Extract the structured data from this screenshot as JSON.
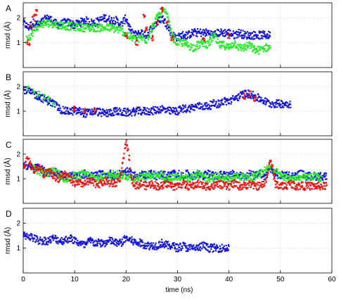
{
  "xlabel": "time (ns)",
  "ylabel": "rmsd (Å)",
  "series_colors": {
    "blue": "#1010e0",
    "green": "#22ee22",
    "red": "#ee1111"
  },
  "chart_data": [
    {
      "panel": "A",
      "type": "scatter",
      "xlim": [
        0,
        60
      ],
      "ylim": [
        0,
        2.6
      ],
      "grid": true,
      "x_ticks": [
        0,
        10,
        20,
        30,
        40,
        50,
        60
      ],
      "y_ticks": [
        1,
        2
      ],
      "series": [
        {
          "color": "blue",
          "x": [
            0,
            1,
            2,
            3,
            4,
            5,
            6,
            7,
            8,
            9,
            10,
            11,
            12,
            13,
            14,
            15,
            16,
            17,
            18,
            19,
            20,
            21,
            22,
            23,
            24,
            25,
            26,
            27,
            28,
            29,
            30,
            31,
            32,
            33,
            34,
            35,
            36,
            37,
            38,
            39,
            40,
            41,
            42,
            43,
            44,
            45,
            46,
            47,
            48
          ],
          "y": [
            1.8,
            1.6,
            1.8,
            1.7,
            1.9,
            2.0,
            1.8,
            1.7,
            1.8,
            1.8,
            1.7,
            1.8,
            1.9,
            1.8,
            1.8,
            1.9,
            2.0,
            1.9,
            1.9,
            1.7,
            2.0,
            1.4,
            1.3,
            1.4,
            1.3,
            1.6,
            1.8,
            2.0,
            1.7,
            1.3,
            1.2,
            1.3,
            1.3,
            1.4,
            1.4,
            1.4,
            1.4,
            1.3,
            1.4,
            1.4,
            1.4,
            1.3,
            1.4,
            1.3,
            1.3,
            1.3,
            1.3,
            1.3,
            1.3
          ]
        },
        {
          "color": "green",
          "x": [
            0.5,
            1.5,
            3,
            5,
            7,
            12,
            17,
            19,
            21,
            22,
            23,
            24,
            26,
            27,
            28,
            29,
            30,
            31,
            32,
            33,
            34,
            35,
            36,
            37,
            38,
            39,
            40,
            41,
            42,
            43,
            44,
            45,
            46,
            47,
            48
          ],
          "y": [
            1.1,
            1.3,
            1.7,
            1.8,
            1.7,
            1.6,
            1.6,
            1.5,
            1.2,
            1.1,
            1.2,
            1.1,
            2.0,
            2.3,
            2.1,
            1.2,
            1.0,
            1.0,
            0.9,
            0.8,
            0.9,
            1.0,
            0.9,
            1.3,
            0.9,
            0.9,
            0.8,
            1.0,
            0.8,
            0.8,
            0.9,
            0.7,
            0.7,
            0.8,
            0.8
          ]
        },
        {
          "color": "red",
          "x": [
            1,
            1.5,
            2,
            2.5,
            20,
            22,
            23.5,
            24,
            25,
            26,
            27,
            28,
            29,
            35,
            40
          ],
          "y": [
            1.0,
            1.6,
            2.0,
            2.2,
            1.3,
            1.0,
            2.0,
            1.5,
            1.2,
            1.8,
            2.3,
            1.8,
            1.2,
            1.2,
            1.3
          ]
        }
      ]
    },
    {
      "panel": "B",
      "type": "scatter",
      "xlim": [
        0,
        60
      ],
      "ylim": [
        0,
        2.6
      ],
      "grid": true,
      "x_ticks": [
        0,
        10,
        20,
        30,
        40,
        50,
        60
      ],
      "y_ticks": [
        1,
        2
      ],
      "series": [
        {
          "color": "blue",
          "x": [
            0,
            1,
            2,
            3,
            4,
            5,
            6,
            7,
            8,
            9,
            10,
            11,
            12,
            13,
            14,
            15,
            16,
            17,
            18,
            19,
            20,
            21,
            22,
            23,
            24,
            25,
            26,
            27,
            28,
            29,
            30,
            31,
            32,
            33,
            34,
            35,
            36,
            37,
            38,
            39,
            40,
            41,
            42,
            43,
            44,
            45,
            46,
            47,
            48,
            49,
            50,
            51,
            52
          ],
          "y": [
            1.9,
            1.8,
            1.7,
            1.6,
            1.5,
            1.4,
            1.3,
            1.1,
            1.0,
            1.0,
            1.0,
            1.0,
            0.9,
            0.95,
            1.0,
            0.95,
            0.9,
            0.95,
            1.0,
            0.95,
            0.95,
            0.95,
            1.0,
            1.0,
            1.0,
            1.0,
            1.05,
            1.1,
            1.0,
            1.0,
            1.0,
            1.1,
            1.1,
            1.15,
            1.2,
            1.2,
            1.2,
            1.3,
            1.3,
            1.4,
            1.4,
            1.5,
            1.6,
            1.7,
            1.7,
            1.6,
            1.5,
            1.4,
            1.3,
            1.3,
            1.3,
            1.3,
            1.3
          ]
        },
        {
          "color": "green",
          "x": [
            1,
            2,
            3,
            4,
            5,
            6
          ],
          "y": [
            1.9,
            1.8,
            1.7,
            1.6,
            1.5,
            1.3
          ]
        },
        {
          "color": "red",
          "x": [
            10,
            12,
            14,
            43,
            44,
            45
          ],
          "y": [
            1.1,
            1.0,
            1.0,
            1.6,
            1.7,
            1.5
          ]
        }
      ]
    },
    {
      "panel": "C",
      "type": "scatter",
      "xlim": [
        0,
        60
      ],
      "ylim": [
        0,
        2.6
      ],
      "grid": true,
      "x_ticks": [
        0,
        10,
        20,
        30,
        40,
        50,
        60
      ],
      "y_ticks": [
        1,
        2
      ],
      "series": [
        {
          "color": "blue",
          "x": [
            0,
            1,
            2,
            3,
            4,
            5,
            6,
            7,
            8,
            9,
            10,
            11,
            12,
            13,
            14,
            15,
            16,
            17,
            18,
            19,
            20,
            21,
            22,
            23,
            24,
            25,
            26,
            27,
            28,
            29,
            30,
            31,
            32,
            33,
            34,
            35,
            36,
            37,
            38,
            39,
            40,
            41,
            42,
            43,
            44,
            45,
            46,
            47,
            48,
            49,
            50,
            51,
            52,
            53,
            54,
            55,
            56,
            57,
            58,
            59
          ],
          "y": [
            1.6,
            1.5,
            1.4,
            1.5,
            1.3,
            1.2,
            1.3,
            1.2,
            1.1,
            1.1,
            1.1,
            1.1,
            1.2,
            1.1,
            1.1,
            1.2,
            1.1,
            1.2,
            1.1,
            1.2,
            1.3,
            1.2,
            1.1,
            1.2,
            1.1,
            1.2,
            1.1,
            1.2,
            1.1,
            1.2,
            1.2,
            1.1,
            1.2,
            1.1,
            1.2,
            1.1,
            1.2,
            1.1,
            1.1,
            1.2,
            1.1,
            1.2,
            1.1,
            1.1,
            1.2,
            1.1,
            1.2,
            1.1,
            1.4,
            1.2,
            1.1,
            1.2,
            1.1,
            1.1,
            1.2,
            1.1,
            1.1,
            1.1,
            1.1,
            1.1
          ]
        },
        {
          "color": "green",
          "x": [
            2,
            4,
            6,
            8,
            10,
            12,
            14,
            16,
            18,
            22,
            24,
            26,
            28,
            30,
            32,
            34,
            36,
            38,
            40,
            42,
            44,
            46,
            48,
            50,
            52,
            54,
            56,
            58
          ],
          "y": [
            1.4,
            1.2,
            1.3,
            1.0,
            1.1,
            1.2,
            1.0,
            1.1,
            1.2,
            1.0,
            1.1,
            1.2,
            1.0,
            1.1,
            1.0,
            1.2,
            1.0,
            1.1,
            1.0,
            1.1,
            1.0,
            1.2,
            1.5,
            1.1,
            1.0,
            1.0,
            1.1,
            1.0
          ]
        },
        {
          "color": "red",
          "x": [
            0,
            1,
            2,
            3,
            4,
            5,
            6,
            7,
            8,
            9,
            10,
            11,
            12,
            13,
            14,
            15,
            16,
            17,
            18,
            19,
            19.5,
            20,
            20.5,
            21,
            22,
            23,
            24,
            25,
            26,
            27,
            28,
            29,
            30,
            31,
            32,
            33,
            34,
            35,
            36,
            37,
            38,
            39,
            40,
            41,
            42,
            43,
            44,
            45,
            46,
            47,
            47.5,
            48,
            48.5,
            49,
            50,
            51,
            52,
            53,
            54,
            55,
            56,
            57,
            58,
            59
          ],
          "y": [
            1.5,
            1.8,
            1.3,
            1.5,
            1.2,
            1.4,
            1.1,
            1.0,
            1.2,
            1.0,
            0.8,
            0.8,
            0.8,
            0.9,
            0.8,
            0.8,
            0.9,
            0.8,
            0.8,
            1.1,
            1.8,
            2.5,
            2.0,
            1.0,
            0.7,
            0.8,
            0.7,
            0.8,
            0.7,
            0.7,
            0.8,
            0.7,
            0.7,
            0.8,
            0.7,
            0.7,
            0.8,
            0.7,
            0.7,
            0.7,
            0.8,
            0.7,
            0.7,
            0.8,
            0.7,
            0.7,
            0.8,
            0.7,
            0.7,
            0.8,
            1.2,
            1.8,
            1.3,
            0.8,
            0.7,
            0.7,
            0.8,
            0.7,
            0.7,
            0.7,
            0.7,
            0.7,
            0.7,
            0.7
          ]
        }
      ]
    },
    {
      "panel": "D",
      "type": "scatter",
      "xlim": [
        0,
        60
      ],
      "ylim": [
        0,
        2.6
      ],
      "grid": true,
      "x_ticks": [
        0,
        10,
        20,
        30,
        40,
        50,
        60
      ],
      "y_ticks": [
        1,
        2
      ],
      "series": [
        {
          "color": "blue",
          "x": [
            0,
            1,
            2,
            3,
            4,
            5,
            6,
            7,
            8,
            9,
            10,
            11,
            12,
            13,
            14,
            15,
            16,
            17,
            18,
            19,
            20,
            21,
            22,
            23,
            24,
            25,
            26,
            27,
            28,
            29,
            30,
            31,
            32,
            33,
            34,
            35,
            36,
            37,
            38,
            39,
            40
          ],
          "y": [
            1.5,
            1.5,
            1.4,
            1.3,
            1.3,
            1.3,
            1.4,
            1.3,
            1.3,
            1.4,
            1.3,
            1.2,
            1.1,
            1.3,
            1.2,
            1.2,
            1.2,
            1.3,
            1.2,
            1.2,
            1.4,
            1.3,
            1.2,
            1.2,
            1.1,
            1.1,
            1.1,
            1.2,
            1.1,
            1.1,
            1.0,
            1.1,
            1.0,
            1.0,
            1.0,
            1.1,
            1.0,
            1.0,
            1.0,
            1.0,
            1.0
          ]
        }
      ]
    }
  ]
}
